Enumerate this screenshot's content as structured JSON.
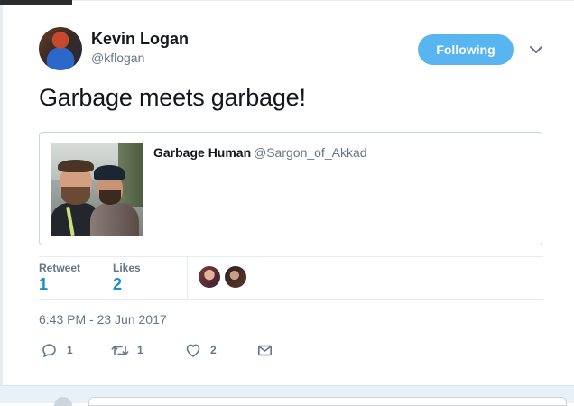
{
  "author": {
    "display_name": "Kevin Logan",
    "handle": "@kflogan"
  },
  "follow_button_label": "Following",
  "tweet_text": "Garbage meets garbage!",
  "quoted_tweet": {
    "display_name": "Garbage Human",
    "handle": "@Sargon_of_Akkad"
  },
  "stats": {
    "retweets_label": "Retweet",
    "retweets_value": "1",
    "likes_label": "Likes",
    "likes_value": "2"
  },
  "timestamp": "6:43 PM - 23 Jun 2017",
  "actions": {
    "reply_count": "1",
    "retweet_count": "1",
    "like_count": "2"
  },
  "colors": {
    "accent": "#1b8fc9",
    "follow_button": "#58b5f0",
    "muted_text": "#657786"
  },
  "icons": [
    "chevron-down-icon",
    "reply-icon",
    "retweet-icon",
    "heart-icon",
    "mail-icon"
  ]
}
